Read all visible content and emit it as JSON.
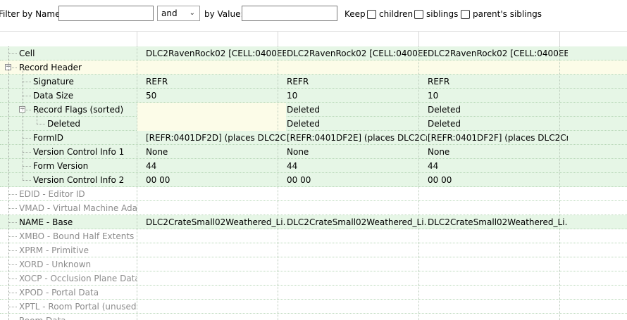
{
  "toolbar": {
    "filter_by_name_label": "Filter by Name:",
    "filter_name_value": "",
    "operator_value": "and",
    "by_value_label": "by Value:",
    "filter_value_value": "",
    "keep_label": "Keep",
    "keep_options": [
      {
        "label": "children",
        "checked": false
      },
      {
        "label": "siblings",
        "checked": false
      },
      {
        "label": "parent's siblings",
        "checked": false
      }
    ]
  },
  "rows": [
    {
      "label": "Cell",
      "values": [
        "DLC2RavenRock02 [CELL:0400EE...",
        "DLC2RavenRock02 [CELL:0400EE...",
        "DLC2RavenRock02 [CELL:0400EE..."
      ]
    },
    {
      "label": "Record Header",
      "values": [
        "",
        "",
        ""
      ]
    },
    {
      "label": "Signature",
      "values": [
        "REFR",
        "REFR",
        "REFR"
      ]
    },
    {
      "label": "Data Size",
      "values": [
        "50",
        "10",
        "10"
      ]
    },
    {
      "label": "Record Flags (sorted)",
      "values": [
        "",
        "Deleted",
        "Deleted"
      ]
    },
    {
      "label": "Deleted",
      "values": [
        "",
        "Deleted",
        "Deleted"
      ]
    },
    {
      "label": "FormID",
      "values": [
        "[REFR:0401DF2D] (places DLC2Cr...",
        "[REFR:0401DF2E] (places DLC2Cr...",
        "[REFR:0401DF2F] (places DLC2Cr..."
      ]
    },
    {
      "label": "Version Control Info 1",
      "values": [
        "None",
        "None",
        "None"
      ]
    },
    {
      "label": "Form Version",
      "values": [
        "44",
        "44",
        "44"
      ]
    },
    {
      "label": "Version Control Info 2",
      "values": [
        "00 00",
        "00 00",
        "00 00"
      ]
    },
    {
      "label": "EDID - Editor ID",
      "values": [
        "",
        "",
        ""
      ]
    },
    {
      "label": "VMAD - Virtual Machine Ada...",
      "values": [
        "",
        "",
        ""
      ]
    },
    {
      "label": "NAME - Base",
      "values": [
        "DLC2CrateSmall02Weathered_Li...",
        "DLC2CrateSmall02Weathered_Li...",
        "DLC2CrateSmall02Weathered_Li..."
      ]
    },
    {
      "label": "XMBO - Bound Half Extents",
      "values": [
        "",
        "",
        ""
      ]
    },
    {
      "label": "XPRM - Primitive",
      "values": [
        "",
        "",
        ""
      ]
    },
    {
      "label": "XORD - Unknown",
      "values": [
        "",
        "",
        ""
      ]
    },
    {
      "label": "XOCP - Occlusion Plane Data",
      "values": [
        "",
        "",
        ""
      ]
    },
    {
      "label": "XPOD - Portal Data",
      "values": [
        "",
        "",
        ""
      ]
    },
    {
      "label": "XPTL - Room Portal (unused)",
      "values": [
        "",
        "",
        ""
      ]
    },
    {
      "label": "Room Data",
      "values": [
        "",
        "",
        ""
      ]
    }
  ],
  "colors": {
    "row_present": "#e6f6e6",
    "row_highlight": "#fcfce8",
    "label_disabled": "#8c8c8c"
  },
  "icons": {
    "expander_expanded": "minus-box-icon",
    "checkbox": "checkbox-icon",
    "dropdown": "chevron-down-icon"
  }
}
